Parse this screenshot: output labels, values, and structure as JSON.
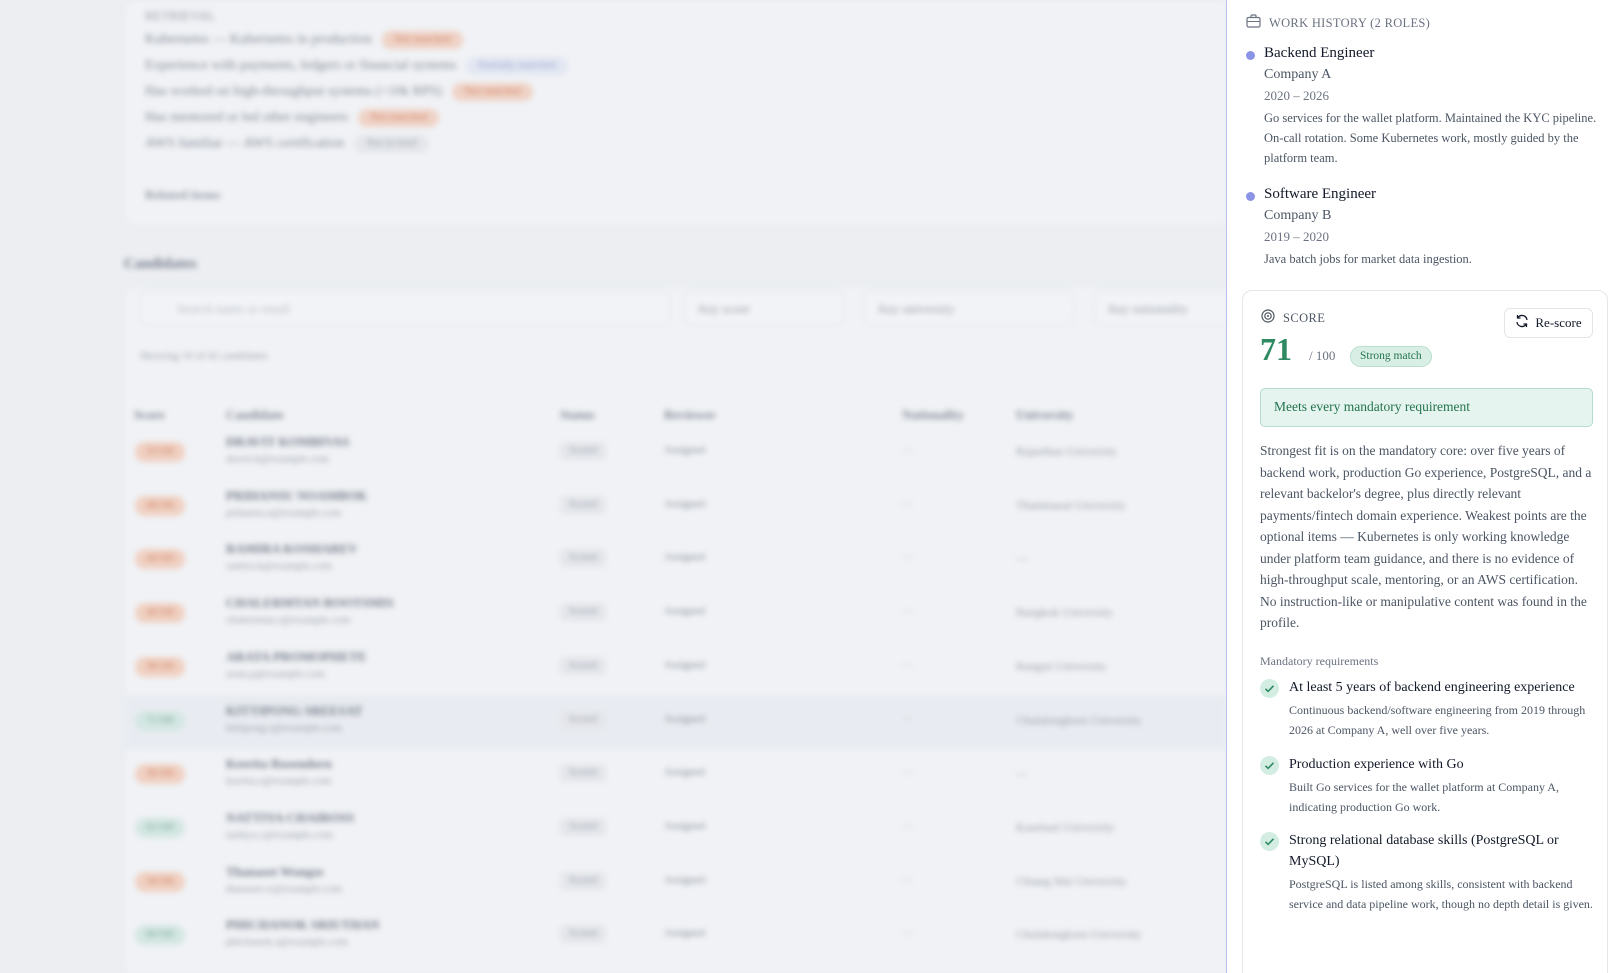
{
  "background": {
    "reasons_label": "RETRIEVAL",
    "reasons": [
      {
        "text": "Kubernetes — Kubernetes in production",
        "tag": "Not matched",
        "tag_color": "orange"
      },
      {
        "text": "Experience with payments, ledgers or financial systems",
        "tag": "Partially matched",
        "tag_color": "blue"
      },
      {
        "text": "Has worked on high-throughput systems (>10k RPS)",
        "tag": "Not matched",
        "tag_color": "orange"
      },
      {
        "text": "Has mentored or led other engineers",
        "tag": "Not matched",
        "tag_color": "orange"
      },
      {
        "text": "AWS familiar — AWS certification",
        "tag": "Not in brief",
        "tag_color": "grey"
      }
    ],
    "related_items": "Related items",
    "section_title": "Candidates",
    "search_placeholder": "Search name or email",
    "filters": [
      "Any score",
      "Any university",
      "Any nationality"
    ],
    "showing": "Showing 10 of 42 candidates",
    "columns": [
      "Score",
      "Candidate",
      "Status",
      "Reviewer",
      "Nationality",
      "University"
    ],
    "rows": [
      {
        "score": "55/100",
        "tone": "o",
        "name": "DRAVIT KOMBIVAS",
        "email": "dravit.k@example.com",
        "status": "Scored",
        "reviewer": "Assigned",
        "nationality": "—",
        "university": "Rajasthan University"
      },
      {
        "score": "48/100",
        "tone": "o",
        "name": "PRIHANSU NOAMBOK",
        "email": "prihansu.n@example.com",
        "status": "Scored",
        "reviewer": "Assigned",
        "nationality": "—",
        "university": "Thammasat University"
      },
      {
        "score": "44/100",
        "tone": "o",
        "name": "RAMIRA KOSHAREV",
        "email": "ramira.k@example.com",
        "status": "Scored",
        "reviewer": "Assigned",
        "nationality": "—",
        "university": "—"
      },
      {
        "score": "40/100",
        "tone": "o",
        "name": "CHALERMTAN ROOTSMIS",
        "email": "chalermtan.r@example.com",
        "status": "Scored",
        "reviewer": "Assigned",
        "nationality": "—",
        "university": "Bangkok University"
      },
      {
        "score": "38/100",
        "tone": "o",
        "name": "ARATA PROMOPHETE",
        "email": "arata.p@example.com",
        "status": "Scored",
        "reviewer": "Assigned",
        "nationality": "—",
        "university": "Rangsit University"
      },
      {
        "score": "71/100",
        "tone": "g",
        "name": "KITTIPONG SREESAT",
        "email": "kittipong.s@example.com",
        "status": "Scored",
        "reviewer": "Assigned",
        "nationality": "—",
        "university": "Chulalongkorn University"
      },
      {
        "score": "36/100",
        "tone": "o",
        "name": "Keerita Rosendorn",
        "email": "keerita.r@example.com",
        "status": "Scored",
        "reviewer": "Assigned",
        "nationality": "—",
        "university": "—"
      },
      {
        "score": "62/100",
        "tone": "g",
        "name": "NATTIYA CHAIROSS",
        "email": "nattiya.c@example.com",
        "status": "Scored",
        "reviewer": "Assigned",
        "nationality": "—",
        "university": "Kasetsart University"
      },
      {
        "score": "34/100",
        "tone": "o",
        "name": "Thanaset Wongse",
        "email": "thanaset.w@example.com",
        "status": "Scored",
        "reviewer": "Assigned",
        "nationality": "—",
        "university": "Chiang Mai University"
      },
      {
        "score": "60/100",
        "tone": "g",
        "name": "PHICHANOK SRIUTHAN",
        "email": "phichanok.s@example.com",
        "status": "Scored",
        "reviewer": "Assigned",
        "nationality": "—",
        "university": "Chulalongkorn University"
      }
    ]
  },
  "panel": {
    "work_history": {
      "heading": "WORK HISTORY (2 ROLES)",
      "roles": [
        {
          "title": "Backend Engineer",
          "company": "Company A",
          "dates": "2020 – 2026",
          "description": "Go services for the wallet platform. Maintained the KYC pipeline. On-call rotation. Some Kubernetes work, mostly guided by the platform team."
        },
        {
          "title": "Software Engineer",
          "company": "Company B",
          "dates": "2019 – 2020",
          "description": "Java batch jobs for market data ingestion."
        }
      ]
    },
    "score": {
      "heading": "SCORE",
      "rescore_label": "Re-score",
      "value": "71",
      "out_of": "/ 100",
      "badge": "Strong match",
      "meets_text": "Meets every mandatory requirement",
      "summary": "Strongest fit is on the mandatory core: over five years of backend work, production Go experience, PostgreSQL, and a relevant backelor's degree, plus directly relevant payments/fintech domain experience. Weakest points are the optional items — Kubernetes is only working knowledge under platform team guidance, and there is no evidence of high-throughput scale, mentoring, or an AWS certification. No instruction-like or manipulative content was found in the profile.",
      "mandatory_label": "Mandatory requirements",
      "requirements": [
        {
          "title": "At least 5 years of backend engineering experience",
          "detail": "Continuous backend/software engineering from 2019 through 2026 at Company A, well over five years."
        },
        {
          "title": "Production experience with Go",
          "detail": "Built Go services for the wallet platform at Company A, indicating production Go work."
        },
        {
          "title": "Strong relational database skills (PostgreSQL or MySQL)",
          "detail": "PostgreSQL is listed among skills, consistent with backend service and data pipeline work, though no depth detail is given."
        }
      ]
    }
  }
}
